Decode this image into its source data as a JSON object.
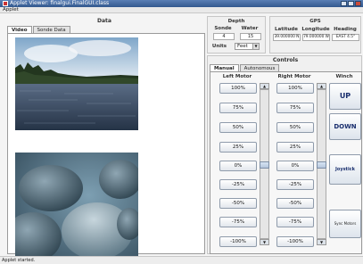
{
  "window": {
    "title": "Applet Viewer: finalgui.FinalGUI.class"
  },
  "menu": {
    "applet": "Applet"
  },
  "data_panel": {
    "title": "Data",
    "tabs": [
      {
        "label": "Video"
      },
      {
        "label": "Sonde Data"
      }
    ]
  },
  "depth": {
    "title": "Depth",
    "sonde_label": "Sonde",
    "water_label": "Water",
    "sonde_value": "4",
    "water_value": "15",
    "units_label": "Units",
    "units_value": "Feet"
  },
  "gps": {
    "title": "GPS",
    "latitude_label": "Latitude",
    "longitude_label": "Longitude",
    "heading_label": "Heading",
    "latitude_value": "39.000000 N",
    "longitude_value": "79.000000 W",
    "heading_value": "EAST 4.5°"
  },
  "controls": {
    "title": "Controls",
    "tabs": [
      {
        "label": "Manual"
      },
      {
        "label": "Autonomous"
      }
    ],
    "left_motor": {
      "label": "Left Motor",
      "buttons": [
        "100%",
        "75%",
        "50%",
        "25%",
        "0%",
        "-25%",
        "-50%",
        "-75%",
        "-100%"
      ]
    },
    "right_motor": {
      "label": "Right Motor",
      "buttons": [
        "100%",
        "75%",
        "50%",
        "25%",
        "0%",
        "-25%",
        "-50%",
        "-75%",
        "-100%"
      ]
    },
    "winch": {
      "label": "Winch",
      "up": "UP",
      "down": "DOWN",
      "joystick": "Joystick",
      "sync": "Sync Motors"
    },
    "left_slider_value": 0,
    "right_slider_value": 0
  },
  "status": {
    "text": "Applet started."
  },
  "colors": {
    "titlebar": "#3b5f95",
    "accent_text": "#1a2f6e"
  }
}
